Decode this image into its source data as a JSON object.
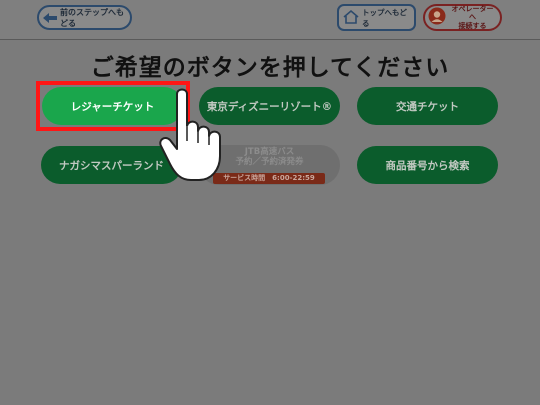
{
  "header": {
    "back_label": "前のステップへもどる",
    "top_label": "トップへもどる",
    "operator_line1": "オペレーターへ",
    "operator_line2": "接続する"
  },
  "title": "ご希望のボタンを押してください",
  "buttons": {
    "leisure": "レジャーチケット",
    "disney": "東京ディズニーリゾート®",
    "transport": "交通チケット",
    "nagashima": "ナガシマスパーランド",
    "jtb_line1": "JTB高速バス",
    "jtb_line2": "予約／予約済発券",
    "jtb_hours": "サービス時間　6:00-22:59",
    "product_search": "商品番号から検索"
  },
  "colors": {
    "active_button": "#1aa64c",
    "highlight": "#ff1515",
    "button_dimmed": "#0b5c2c"
  }
}
